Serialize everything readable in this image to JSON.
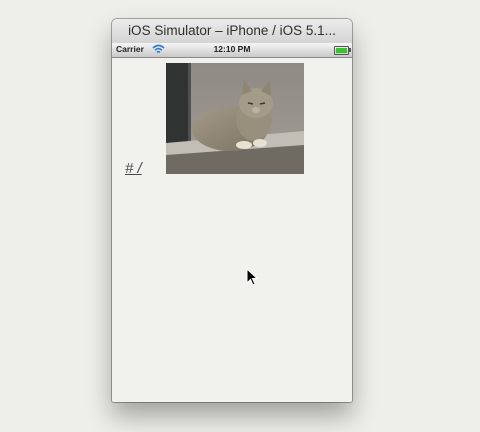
{
  "window": {
    "title": "iOS Simulator – iPhone / iOS 5.1..."
  },
  "status_bar": {
    "carrier": "Carrier",
    "time": "12:10 PM",
    "wifi_icon": "wifi-icon",
    "battery_icon": "battery-icon",
    "battery_color": "#35c42f"
  },
  "content": {
    "link_text": "# /",
    "image_icon": "cat-photo"
  }
}
